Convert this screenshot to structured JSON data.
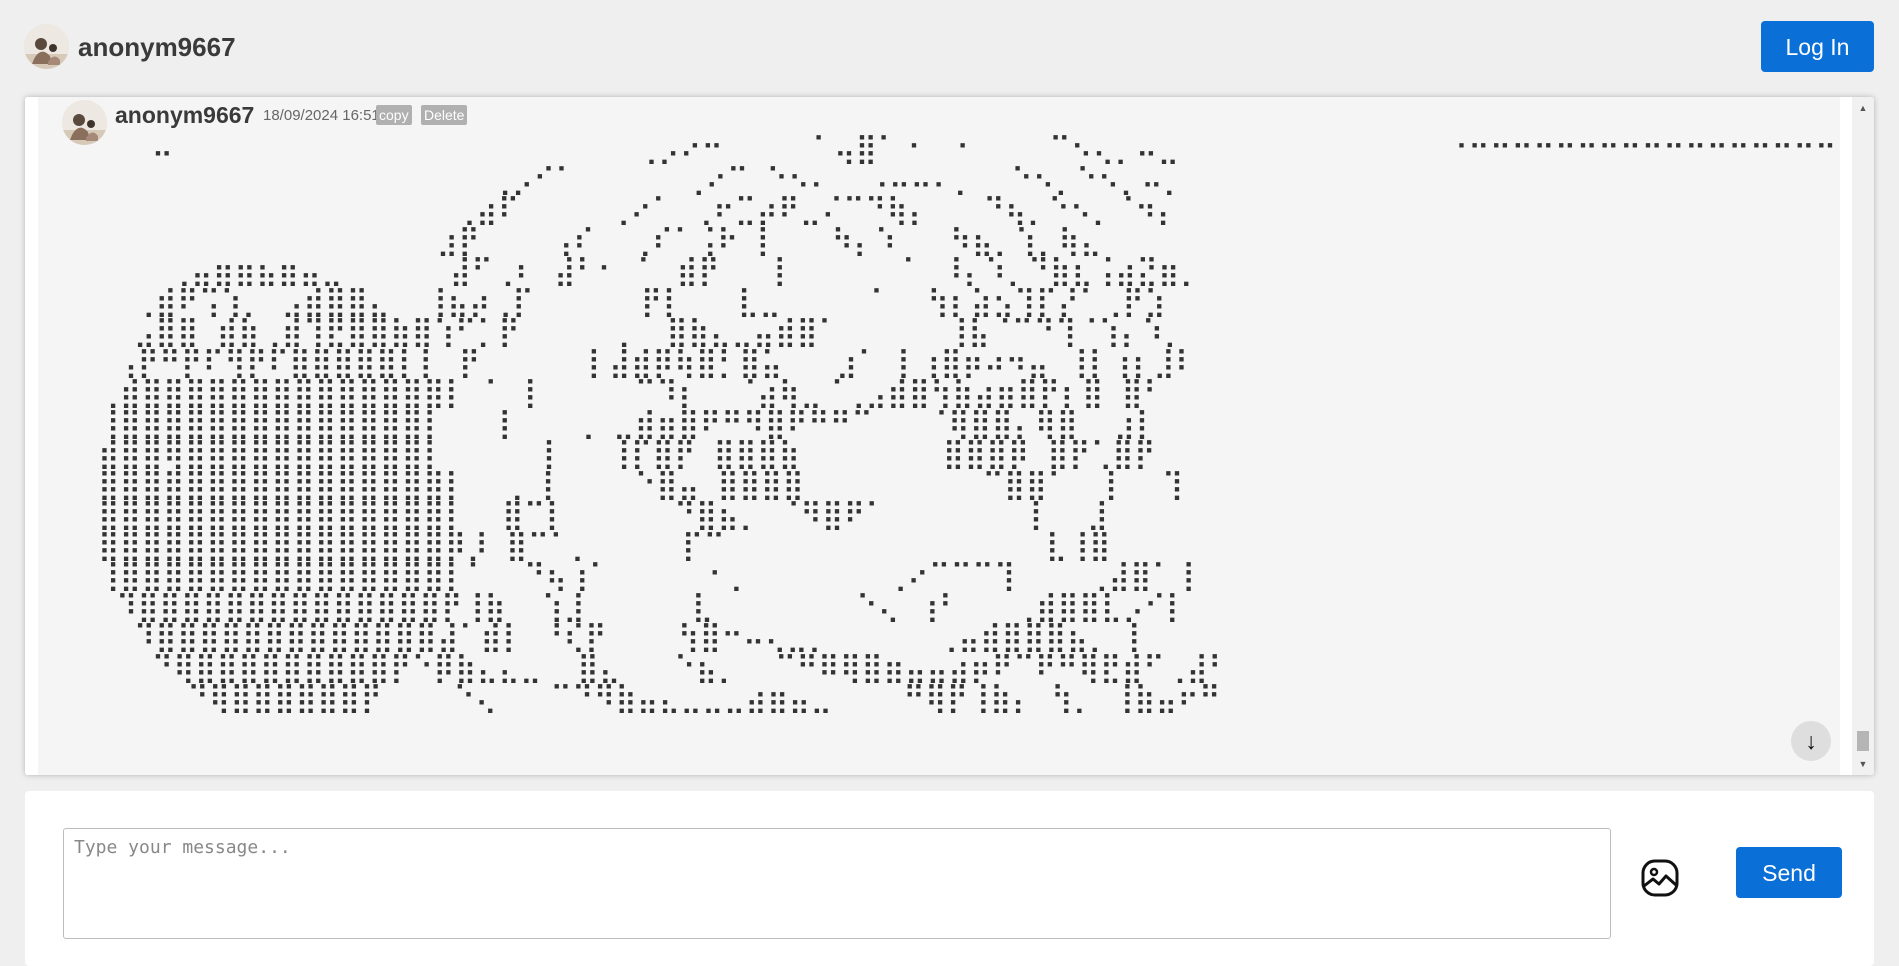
{
  "header": {
    "username": "anonym9667",
    "login_label": "Log In"
  },
  "message": {
    "username": "anonym9667",
    "timestamp": "18/09/2024 16:51",
    "copy_label": "copy",
    "delete_label": "Delete",
    "art": "   ⠤                          ⢀⡠⠔⠒     ⠁⢤⣿⠁⠐  ⠂    ⠉⠢⢄⡀⠤⣀               ⠐⠒⠒⠒⠒⠒⠒⠒⠒⠒⠒⠒⠒⠒⠒⠒⠒⠒⠒⠒\n                      ⢀⡠⠊⠁      ⢀⠔⠉ ⠑⠢⠄  ⠠⠤⠤⠄⡀  ⠑⠢⡀⠑⠢⡀⠤⡀\n                    ⢀⣴⠏     ⢀⠔⠁ ⢀⠖⣉⡴⠟⣀⠌⠉⠙⢷⡄   ⠙⢦⡀⠑⠢⡀⠈⠲⡄\n                   ⣰⡟    ⢠⠎  ⢀⠎⠁⢨⠗ ⡇   ⠳⡄⠱   ⠳⣦⡀⢱⡀⢷⣄\n    ⢀⣤⣶⣶⣦⣶⣤⣀      ⣼⠋⢀⠆ ⣼⠃⠂ ⠁ ⣾⡟   ⡇      ⠁ ⠸⡄⠱⡀⠙⣷⣆⢨⣴⣝⣶⡀\n  ⢀⣾⠟⢩⢱⡀ ⣠⣾⣿⣿⣄  ⢸⣦⡴⢀⡏      ⡟⡇   ⣇⣀     ⠁  ⢳⡆⣵⣢⢹⡏⡜⠁⢀⡟⣱\n  ⣠⣿⣿ ⣾⣷⢀⣾⢹⣟⣿⣿⣷⣿⢱⠋⡁⡟     ⢀  ⣿⣷⣄⣀⣤⣾⣿⠁      ⢸⣧⠈⠉⠙⢹⠈⢱⡄⠱⡀\n ⢠⡟⠛⡟⠏⢻⡟⠏⣿⣿⣿⣿⣿⡇⡇ ⡟      ⡇⣼⣾⡿⢷⣿⡃⣿⣥   ⣰⠁ ⡇⢰⣿⡶⠴⠲⣤ ⢸⡇⢰⡆⣸⠇\n⢀⣾⣿⣿⣿⣿⣿⣿⣿⣿⣿⣿⣿⣿⣿⣿⡇ ⠁ ⡇     ⠉⠹⡆  ⠈⣴⢷⣀⠈⢀⣠⣾⣿⢳⣷⣴⣶⣿⡟⡆⣿ ⣿⠃\n⢸⣿⣿⣿⣿⣿⣿⣿⣿⣿⣿⣿⣿⣿⣿⡇   ⡇   ⢀ ⣀⣾⣶⣿⠟⠛⠻⣿⠟⠛⠛⠉   ⠈⢿⣿⣿⡄⢿⣿  ⣰⡇\n⣾⣿⣿⢿⣿⣿⣿⣿⣿⣿⣿⣿⣿⣿⣿⡇     ⢸   ⢸⡏⣿⡟ ⣿⣿⣿⣷        ⣿⣿⣿⡿ ⣿⡟⢁⣿⡟\n⣿⣿⣿⣿⣿⣿⣿⣿⣿⣿⣿⣿⣿⣿⣿⣿⡇  ⢀ ⡇    ⠑⣿⣤ ⣿⣿⣿⣿          ⠉⣿⣿⠁  ⡇  ⢹\n⣿⣿⣿⣿⣿⣿⣿⣿⣿⣿⣿⣿⣿⣿⣿⣿⡇  ⣿⠉⡇      ⠙⣿⣦⡀ ⠈⠻⣿⠟⠁        ⡇  ⣸\n⣿⣿⣿⣿⣿⣿⣿⣿⣿⣿⣿⣿⣿⣿⣿⣿⡿⡸ ⣿⠉⠁⡀     ⡏⠉                  ⣇⢸⣿\n⢸⣿⣿⣿⣿⣿⣿⣿⣿⣿⣿⣿⣿⣿⣿⣿⡇⠁  ⠙⢦⢰⠁     ⠐⢀        ⢀⠔⠉⠉⠉⢹    ⢀⣼⣿⠁⢸\n ⠹⣿⣿⣿⣿⣿⣿⣿⣿⣿⣿⣿⣿⣿⣿⡟⢸⣷  ⢱⣸      ⣇        ⠑⢄ ⢰⠃   ⢀⣾⣿⣿⣇⡠⠊⡇\n  ⠹⣿⣿⣿⣿⣿⣿⣿⣿⣿⣿⣿⣿⣿⣼⠁⣾⡇ ⠘⢎⡟    ⢳⣿⠒⠤⢄⣀⡀      ⢀⣤⣾⣿⣿⣿⣦⡀ ⡇\n   ⠙⢿⣿⣿⣿⣿⣿⣿⣿⣿⣿⡟⠑⡿⣷⣄⣄⣀  ⣿⣄   ⠑⣦⡀  ⠉⠛⠿⢿⣿⣶⣤⣤⣴⡶⠟⠉⠟⠛⢿⣟⣾⠋⢀⣼⠃\n     ⠙⢿⣿⣿⣿⣿⣿⣿⡟    ⠑⢄   ⠉⠙⠻⣷⣤⣄⣀⣀⣀⣴⣶⣤⣀    ⠛⢿⡟⢸⣷⡄ ⢳⡀ ⢸⣷⣤⠖⠛"
  },
  "composer": {
    "placeholder": "Type your message...",
    "send_label": "Send"
  }
}
